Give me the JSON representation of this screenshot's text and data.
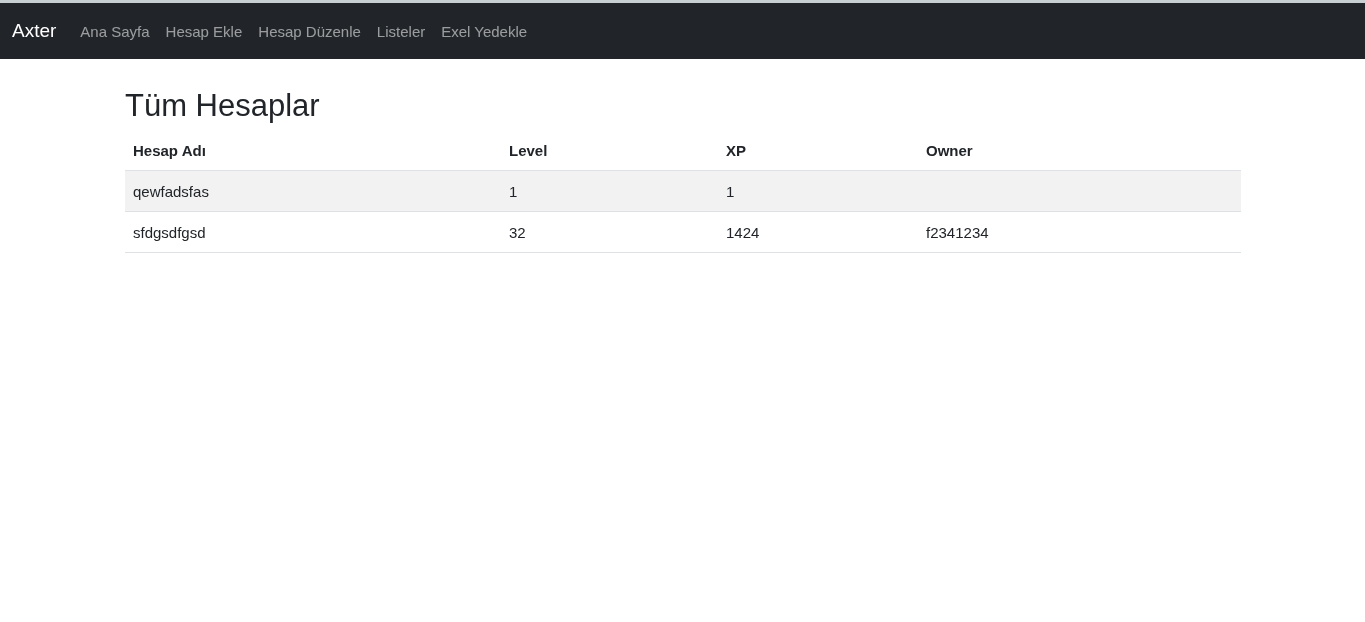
{
  "navbar": {
    "brand": "Axter",
    "links": [
      {
        "label": "Ana Sayfa"
      },
      {
        "label": "Hesap Ekle"
      },
      {
        "label": "Hesap Düzenle"
      },
      {
        "label": "Listeler"
      },
      {
        "label": "Exel Yedekle"
      }
    ]
  },
  "heading": "Tüm Hesaplar",
  "table": {
    "columns": [
      "Hesap Adı",
      "Level",
      "XP",
      "Owner"
    ],
    "rows": [
      {
        "cells": [
          "qewfadsfas",
          "1",
          "1",
          null
        ]
      },
      {
        "cells": [
          "sfdgsdfgsd",
          "32",
          "1424",
          "f2341234"
        ]
      }
    ]
  }
}
